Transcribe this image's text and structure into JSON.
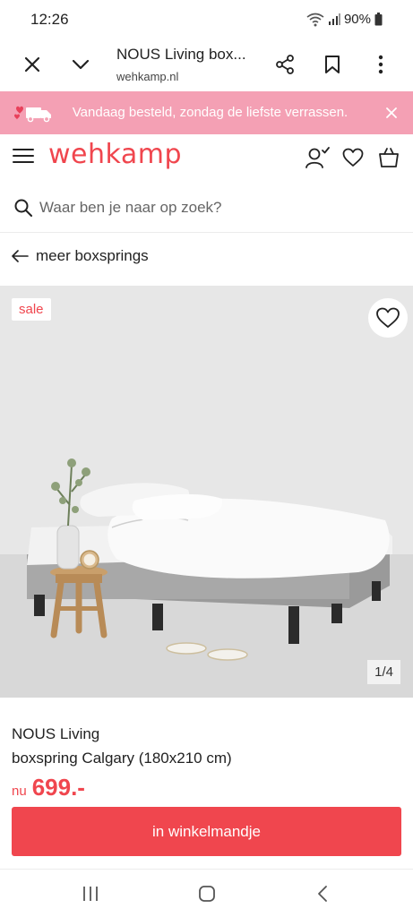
{
  "status_bar": {
    "time": "12:26",
    "battery": "90%",
    "icons": [
      "wifi-icon",
      "signal-icon",
      "battery-icon"
    ]
  },
  "browser": {
    "page_title": "NOUS Living box...",
    "url": "wehkamp.nl",
    "icons": [
      "close-icon",
      "chevron-down-icon",
      "share-icon",
      "bookmark-icon",
      "more-vert-icon"
    ]
  },
  "promo": {
    "text": "Vandaag besteld, zondag de liefste verrassen.",
    "icons": [
      "hearts-truck-icon",
      "close-icon"
    ]
  },
  "header": {
    "logo": "wehkamp",
    "icons": [
      "menu-icon",
      "account-icon",
      "heart-icon",
      "bag-icon"
    ]
  },
  "search": {
    "placeholder": "Waar ben je naar op zoek?",
    "value": ""
  },
  "breadcrumb": {
    "back_label": "meer boxsprings"
  },
  "product": {
    "badge": "sale",
    "image_counter": "1/4",
    "brand": "NOUS Living",
    "name": "boxspring Calgary (180x210 cm)",
    "price_prefix": "nu",
    "price": "699.-",
    "cart_label": "in winkelmandje"
  },
  "colors": {
    "brand": "#f0464e",
    "promo_background": "#f4a0b4",
    "image_background": "#eaeaea"
  },
  "nav": {
    "icons": [
      "recent-apps-icon",
      "home-icon",
      "back-icon"
    ]
  }
}
